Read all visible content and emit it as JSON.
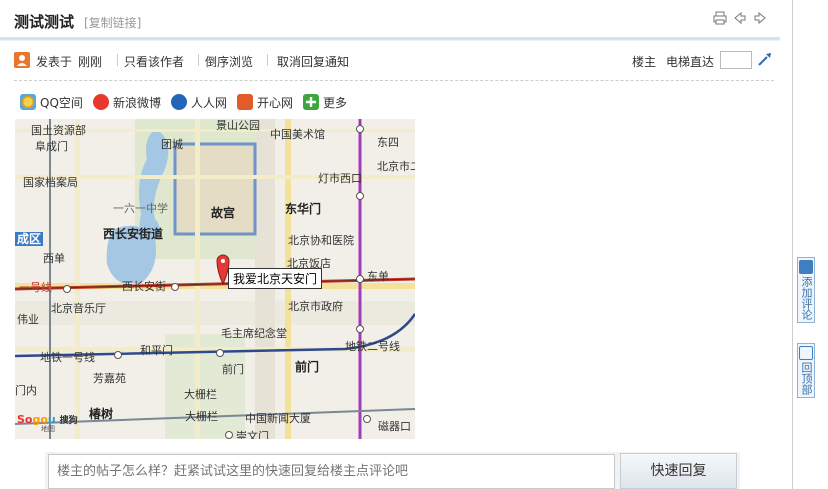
{
  "header": {
    "title": "测试测试",
    "copy_link": "[复制链接]"
  },
  "meta": {
    "posted_label": "发表于",
    "posted_time": "刚刚",
    "only_author": "只看该作者",
    "reverse_order": "倒序浏览",
    "cancel_notify": "取消回复通知",
    "floor_owner": "楼主",
    "elevator": "电梯直达",
    "elevator_value": ""
  },
  "share": {
    "items": [
      "QQ空间",
      "新浪微博",
      "人人网",
      "开心网",
      "更多"
    ]
  },
  "map": {
    "marker_label": "我爱北京天安门",
    "labels": {
      "l1": "国土资源部",
      "l2": "阜成门",
      "l3": "景山公园",
      "l4": "中国美术馆",
      "l5": "团城",
      "l6": "东四",
      "l7": "北京市二",
      "l8": "国家档案局",
      "l9": "灯市西口",
      "l10": "一六一中学",
      "l11": "故宫",
      "l12": "东华门",
      "l13": "西长安街道",
      "l14": "北京协和医院",
      "l15": "成区",
      "l16": "西单",
      "l17": "北京饭店",
      "l18": "一号线",
      "l19": "西长安街",
      "l20": "东单",
      "l21": "伟业",
      "l22": "北京音乐厅",
      "l23": "北京市政府",
      "l24": "毛主席纪念堂",
      "l25": "地铁一号线",
      "l26": "和平门",
      "l27": "地铁二号线",
      "l28": "芳嘉苑",
      "l29": "前门",
      "l30": "门内",
      "l31": "大栅栏",
      "l32": "椿树",
      "l33": "中国新闻大厦",
      "l34": "磁器口",
      "l35": "崇文门"
    },
    "logo_text": "搜狗",
    "logo_sub": "地图"
  },
  "reply": {
    "placeholder": "楼主的帖子怎么样？赶紧试试这里的快速回复给楼主点评论吧",
    "button": "快速回复"
  },
  "side": {
    "add_comment": "添加评论",
    "back_top": "回顶部"
  },
  "colors": {
    "accent_blue": "#3d7fc1",
    "subway_red": "#c0392b",
    "subway_purple": "#a23bb8",
    "subway_blue": "#2c4a8c"
  }
}
